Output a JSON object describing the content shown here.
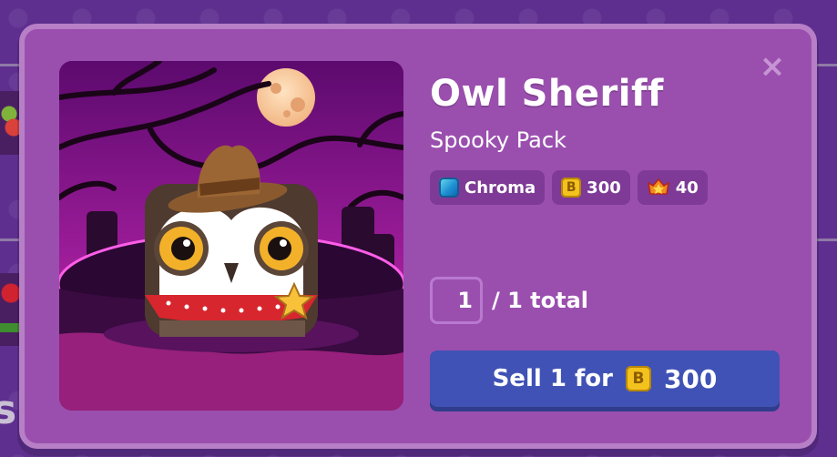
{
  "modal": {
    "close_icon": "×",
    "item": {
      "name": "Owl Sheriff",
      "pack": "Spooky Pack",
      "badges": [
        {
          "icon": "chroma-icon",
          "label": "Chroma"
        },
        {
          "icon": "token-icon",
          "label": "300"
        },
        {
          "icon": "xp-icon",
          "label": "40"
        }
      ]
    },
    "quantity": {
      "value": "1",
      "total_label": "/ 1 total"
    },
    "sell_button": {
      "label": "Sell 1 for",
      "token_glyph": "B",
      "price": "300"
    }
  },
  "background": {
    "corner_text": "s"
  },
  "colors": {
    "page_bg": "#5e2f8f",
    "modal_bg": "#9a4fae",
    "sell_button": "#4052b5",
    "token": "#f4c21d"
  }
}
